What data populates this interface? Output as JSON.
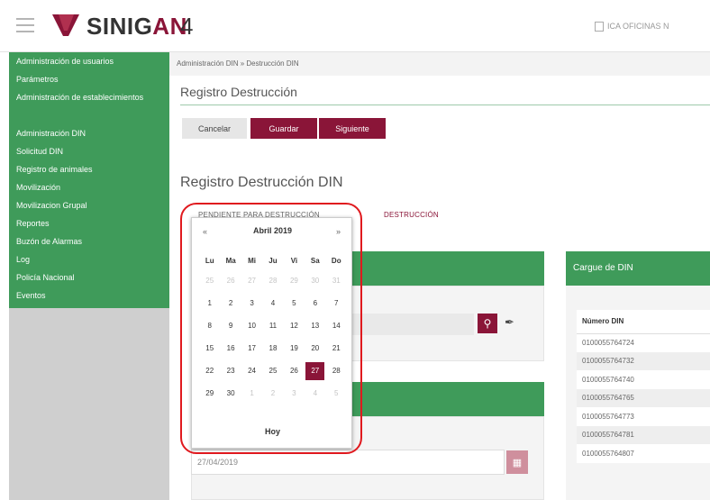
{
  "header": {
    "logo_text_main": "SINIG",
    "logo_text_accent": "AN",
    "version": "4",
    "office": "ICA OFICINAS N"
  },
  "sidebar": {
    "items": [
      {
        "label": "Administración de usuarios"
      },
      {
        "label": "Parámetros"
      },
      {
        "label": "Administración de establecimientos"
      },
      {
        "label": "Administración DIN"
      },
      {
        "label": "Solicitud DIN"
      },
      {
        "label": "Registro de animales"
      },
      {
        "label": "Movilización"
      },
      {
        "label": "Movilizacion Grupal"
      },
      {
        "label": "Reportes"
      },
      {
        "label": "Buzón de Alarmas"
      },
      {
        "label": "Log"
      },
      {
        "label": "Policía Nacional"
      },
      {
        "label": "Eventos"
      }
    ]
  },
  "main": {
    "breadcrumb": "Administración DIN » Destrucción DIN",
    "page_title": "Registro Destrucción",
    "buttons": {
      "cancel": "Cancelar",
      "save": "Guardar",
      "next": "Siguiente"
    },
    "section_title": "Registro Destrucción DIN",
    "tabs": {
      "pending": "PENDIENTE PARA DESTRUCCIÓN",
      "destruction": "DESTRUCCIÓN"
    },
    "date_value": "27/04/2019"
  },
  "calendar": {
    "prev": "«",
    "next": "»",
    "month": "Abril 2019",
    "weekdays": [
      "Lu",
      "Ma",
      "Mi",
      "Ju",
      "Vi",
      "Sa",
      "Do"
    ],
    "weeks": [
      [
        "25",
        "26",
        "27",
        "28",
        "29",
        "30",
        "31"
      ],
      [
        "1",
        "2",
        "3",
        "4",
        "5",
        "6",
        "7"
      ],
      [
        "8",
        "9",
        "10",
        "11",
        "12",
        "13",
        "14"
      ],
      [
        "15",
        "16",
        "17",
        "18",
        "19",
        "20",
        "21"
      ],
      [
        "22",
        "23",
        "24",
        "25",
        "26",
        "27",
        "28"
      ],
      [
        "29",
        "30",
        "1",
        "2",
        "3",
        "4",
        "5"
      ]
    ],
    "selected": "27",
    "today_label": "Hoy"
  },
  "cargue": {
    "title": "Cargue de DIN",
    "column_header": "Número DIN",
    "rows": [
      "0100055764724",
      "0100055764732",
      "0100055764740",
      "0100055764765",
      "0100055764773",
      "0100055764781",
      "0100055764807"
    ]
  },
  "colors": {
    "brand_green": "#3f9b5a",
    "brand_maroon": "#8a1538",
    "highlight_red": "#e0191e"
  }
}
